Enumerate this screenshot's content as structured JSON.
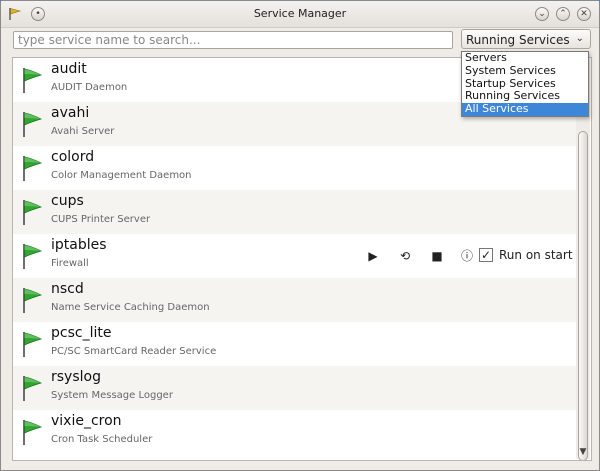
{
  "window": {
    "title": "Service Manager"
  },
  "search": {
    "placeholder": "type service name to search...",
    "value": ""
  },
  "filter": {
    "selected": "Running Services",
    "options": [
      "Servers",
      "System Services",
      "Startup Services",
      "Running Services",
      "All Services"
    ],
    "highlighted": "All Services"
  },
  "services": [
    {
      "name": "audit",
      "description": "AUDIT Daemon"
    },
    {
      "name": "avahi",
      "description": "Avahi Server"
    },
    {
      "name": "colord",
      "description": "Color Management Daemon"
    },
    {
      "name": "cups",
      "description": "CUPS Printer Server"
    },
    {
      "name": "iptables",
      "description": "Firewall"
    },
    {
      "name": "nscd",
      "description": "Name Service Caching Daemon"
    },
    {
      "name": "pcsc_lite",
      "description": "PC/SC SmartCard Reader Service"
    },
    {
      "name": "rsyslog",
      "description": "System Message Logger"
    },
    {
      "name": "vixie_cron",
      "description": "Cron Task Scheduler"
    }
  ],
  "row_actions": {
    "service": "iptables",
    "run_on_start_label": "Run on start",
    "run_on_start_checked": true,
    "icons": [
      "start-icon",
      "restart-icon",
      "stop-icon",
      "info-icon"
    ]
  },
  "colors": {
    "flag_green": "#2fa62f",
    "selection": "#3d86d8"
  }
}
